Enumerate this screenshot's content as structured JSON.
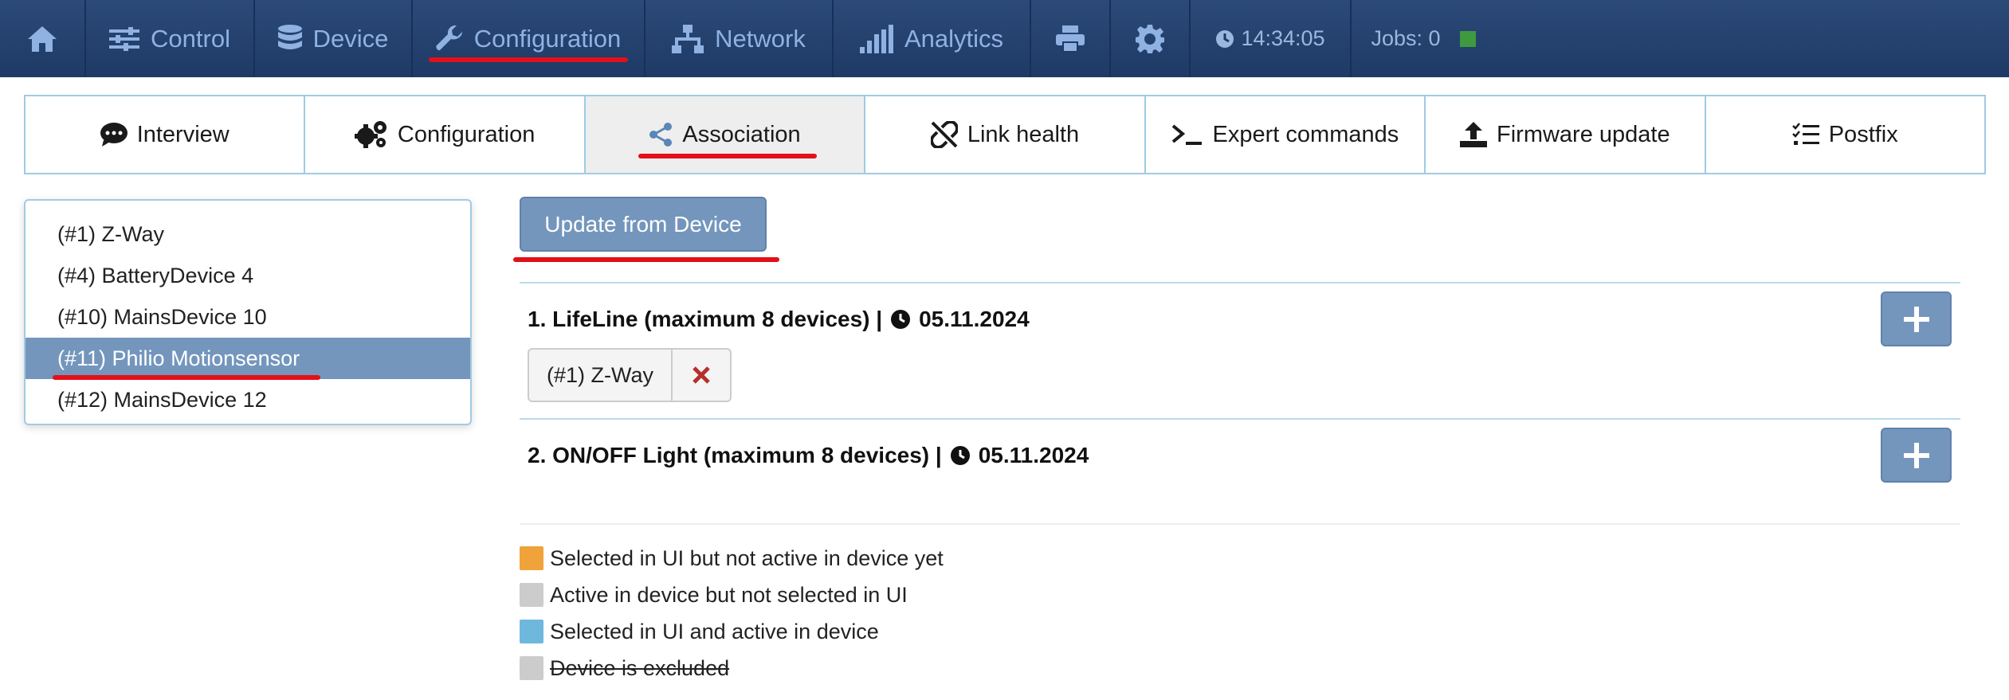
{
  "navbar": {
    "items": [
      {
        "name": "home",
        "label": ""
      },
      {
        "name": "control",
        "label": "Control"
      },
      {
        "name": "device",
        "label": "Device"
      },
      {
        "name": "configuration",
        "label": "Configuration"
      },
      {
        "name": "network",
        "label": "Network"
      },
      {
        "name": "analytics",
        "label": "Analytics"
      },
      {
        "name": "print",
        "label": ""
      },
      {
        "name": "settings",
        "label": ""
      }
    ],
    "clock": "14:34:05",
    "jobs": "Jobs: 0",
    "active": "Configuration"
  },
  "tabs": [
    {
      "label": "Interview",
      "icon": "comment-icon"
    },
    {
      "label": "Configuration",
      "icon": "gears-icon"
    },
    {
      "label": "Association",
      "icon": "share-icon"
    },
    {
      "label": "Link health",
      "icon": "broken-link-icon"
    },
    {
      "label": "Expert commands",
      "icon": "terminal-icon"
    },
    {
      "label": "Firmware update",
      "icon": "upload-icon"
    },
    {
      "label": "Postfix",
      "icon": "checklist-icon"
    }
  ],
  "active_tab": "Association",
  "devices": [
    {
      "label": "(#1) Z-Way"
    },
    {
      "label": "(#4) BatteryDevice 4"
    },
    {
      "label": "(#10) MainsDevice 10"
    },
    {
      "label": "(#11) Philio Motionsensor"
    },
    {
      "label": "(#12) MainsDevice 12"
    }
  ],
  "selected_device": "(#11) Philio Motionsensor",
  "update_button": "Update from Device",
  "groups": [
    {
      "title": "1. LifeLine (maximum 8 devices) |",
      "date": "05.11.2024",
      "members": [
        "(#1) Z-Way"
      ]
    },
    {
      "title": "2. ON/OFF Light (maximum 8 devices) |",
      "date": "05.11.2024",
      "members": []
    }
  ],
  "legend": [
    {
      "label": "Selected in UI but not active in device yet",
      "color": "#f0a33a"
    },
    {
      "label": "Active in device but not selected in UI",
      "color": "#cccccc"
    },
    {
      "label": "Selected in UI and active in device",
      "color": "#6fb8dd"
    },
    {
      "label": "Device is excluded",
      "color": "#cccccc"
    }
  ],
  "colors": {
    "navbar": "#1e3a66",
    "accent": "#7496bd",
    "highlight": "#e3101a"
  }
}
